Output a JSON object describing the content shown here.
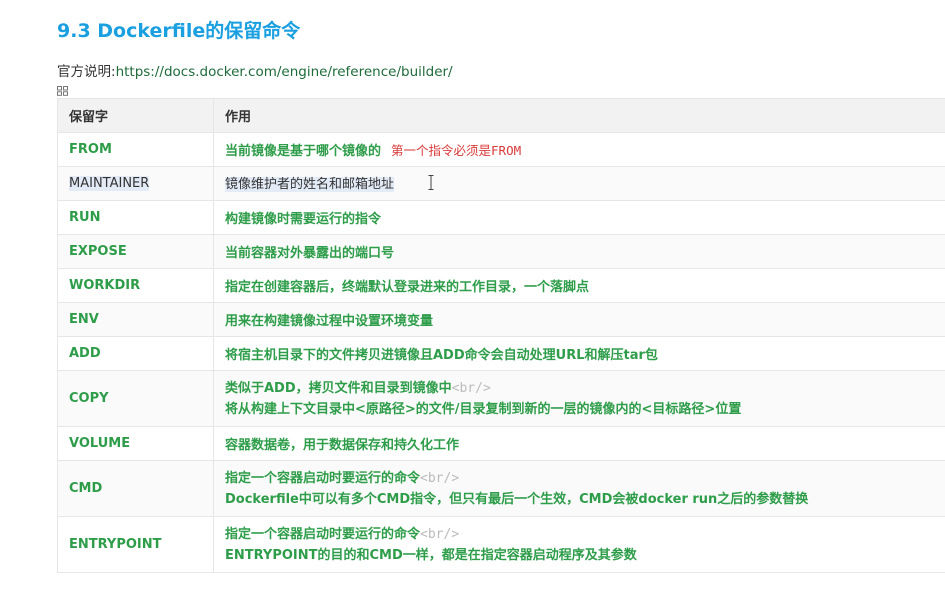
{
  "section_title": "9.3 Dockerfile的保留命令",
  "official_desc": {
    "label": "官方说明:",
    "url": "https://docs.docker.com/engine/reference/builder/"
  },
  "icons": {
    "table_handle": "grid-handle-icon",
    "text_cursor": "text-cursor-icon"
  },
  "colors": {
    "heading": "#1a9fe0",
    "keyword": "#2e9d4a",
    "note": "#d93a3a",
    "tag": "#bbbbbb"
  },
  "table": {
    "headers": [
      "保留字",
      "作用"
    ],
    "rows": [
      {
        "keyword": "FROM",
        "desc": [
          "当前镜像是基于哪个镜像的"
        ],
        "note": "第一个指令必须是FROM"
      },
      {
        "keyword": "MAINTAINER",
        "desc": [
          "镜像维护者的姓名和邮箱地址"
        ]
      },
      {
        "keyword": "RUN",
        "desc": [
          "构建镜像时需要运行的指令"
        ]
      },
      {
        "keyword": "EXPOSE",
        "desc": [
          "当前容器对外暴露出的端口号"
        ]
      },
      {
        "keyword": "WORKDIR",
        "desc": [
          "指定在创建容器后，终端默认登录进来的工作目录，一个落脚点"
        ]
      },
      {
        "keyword": "ENV",
        "desc": [
          "用来在构建镜像过程中设置环境变量"
        ]
      },
      {
        "keyword": "ADD",
        "desc": [
          "将宿主机目录下的文件拷贝进镜像且ADD命令会自动处理URL和解压tar包"
        ]
      },
      {
        "keyword": "COPY",
        "desc": [
          "类似于ADD，拷贝文件和目录到镜像中",
          "将从构建上下文目录中<原路径>的文件/目录复制到新的一层的镜像内的<目标路径>位置"
        ],
        "tag": "<br/>"
      },
      {
        "keyword": "VOLUME",
        "desc": [
          "容器数据卷，用于数据保存和持久化工作"
        ]
      },
      {
        "keyword": "CMD",
        "desc": [
          "指定一个容器启动时要运行的命令",
          "Dockerfile中可以有多个CMD指令，但只有最后一个生效，CMD会被docker run之后的参数替换"
        ],
        "tag": "<br/>"
      },
      {
        "keyword": "ENTRYPOINT",
        "desc": [
          "指定一个容器启动时要运行的命令",
          "ENTRYPOINT的目的和CMD一样，都是在指定容器启动程序及其参数"
        ],
        "tag": "<br/>"
      }
    ]
  }
}
